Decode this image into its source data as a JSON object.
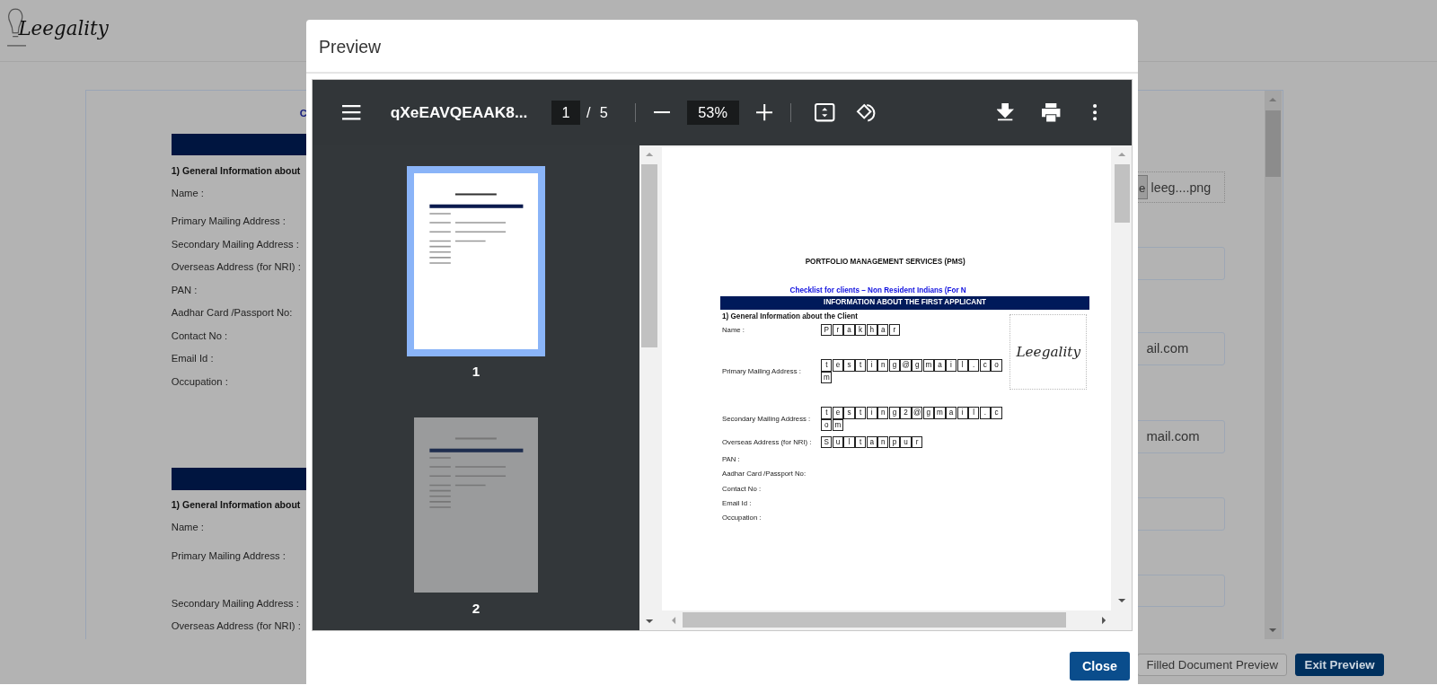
{
  "header": {
    "logo": "Leegality"
  },
  "form": {
    "heading": "C",
    "sections": [
      {
        "title": "1) General Information about",
        "labels": [
          "Name :",
          "Primary Mailing Address :",
          "Secondary Mailing Address :",
          "Overseas Address (for NRI) :",
          "PAN :",
          "Aadhar Card /Passport No:",
          "Contact No :",
          "Email Id :",
          "Occupation :"
        ]
      },
      {
        "title": "1) General Information about",
        "labels": [
          "Name :",
          "Primary Mailing Address :",
          "Secondary Mailing Address :",
          "Overseas Address (for NRI) :"
        ]
      }
    ],
    "fields": [
      {
        "kind": "file",
        "button": "e",
        "value": "leeg....png"
      },
      {
        "kind": "text"
      },
      {
        "kind": "text",
        "value": "ail.com"
      },
      {
        "kind": "text",
        "value": "mail.com"
      },
      {
        "kind": "text"
      },
      {
        "kind": "text"
      }
    ]
  },
  "footer": {
    "buttons": [
      {
        "label": "Filled Document Preview",
        "kind": "secondary"
      },
      {
        "label": "Exit Preview",
        "kind": "primary"
      }
    ]
  },
  "modal": {
    "title": "Preview",
    "viewer": {
      "file_name": "qXeEAVQEAAK8...",
      "page": "1",
      "separator": "/",
      "page_count": "5",
      "zoom": "53%",
      "thumbnails": [
        {
          "number": "1",
          "selected": true
        },
        {
          "number": "2",
          "selected": false
        }
      ],
      "document": {
        "title": "PORTFOLIO MANAGEMENT SERVICES (PMS)",
        "subtitle": "Checklist for clients – Non Resident Indians (For N",
        "section_header": "INFORMATION ABOUT THE FIRST APPLICANT",
        "section_title": "1) General Information about the Client",
        "signature": "Leegality",
        "fields": [
          {
            "label": "Name :",
            "cells": [
              "P",
              "r",
              "a",
              "k",
              "h",
              "a",
              "r"
            ]
          },
          {
            "label": "Primary Mailing Address :",
            "cells": [
              "t",
              "e",
              "s",
              "t",
              "i",
              "n",
              "g",
              "@",
              "g",
              "m",
              "a",
              "i",
              "l",
              ".",
              "c",
              "o",
              "m"
            ]
          },
          {
            "label": "Secondary Mailing Address :",
            "cells": [
              "t",
              "e",
              "s",
              "t",
              "i",
              "n",
              "g",
              "2",
              "@",
              "g",
              "m",
              "a",
              "i",
              "l",
              ".",
              "c",
              "o",
              "m"
            ]
          },
          {
            "label": "Overseas Address (for NRI) :",
            "cells": [
              "S",
              "u",
              "l",
              "t",
              "a",
              "n",
              "p",
              "u",
              "r"
            ]
          },
          {
            "label": "PAN :"
          },
          {
            "label": "Aadhar Card /Passport No:"
          },
          {
            "label": "Contact No :"
          },
          {
            "label": "Email Id :"
          },
          {
            "label": "Occupation :"
          }
        ]
      }
    },
    "buttons": [
      {
        "label": "Close"
      }
    ]
  }
}
